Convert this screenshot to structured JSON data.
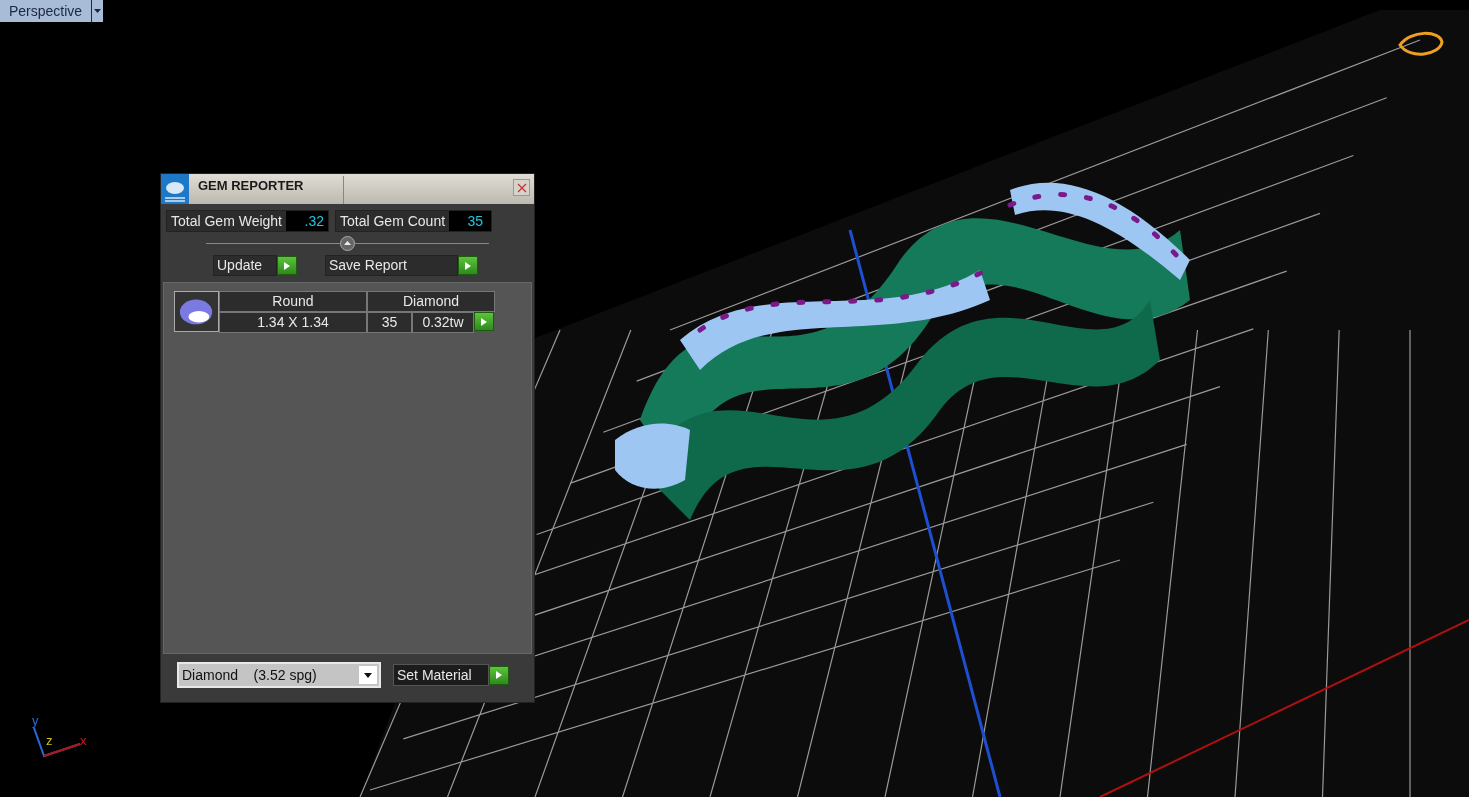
{
  "viewport": {
    "view_label": "Perspective",
    "axes": [
      {
        "kind": "y",
        "label": "y"
      },
      {
        "kind": "z",
        "label": "z"
      },
      {
        "kind": "x",
        "label": "x"
      }
    ]
  },
  "gem_reporter": {
    "title": "GEM REPORTER",
    "total_weight": {
      "label": "Total Gem Weight",
      "value": ".32"
    },
    "total_count": {
      "label": "Total Gem Count",
      "value": "35"
    },
    "buttons": [
      "Update",
      "Save Report"
    ],
    "gems": [
      {
        "shape": "Round",
        "material": "Diamond",
        "size": "1.34 X 1.34",
        "count": "35",
        "weight": "0.32tw"
      }
    ],
    "material_select": {
      "value": "Diamond    (3.52 spg)"
    },
    "set_material": "Set Material"
  }
}
